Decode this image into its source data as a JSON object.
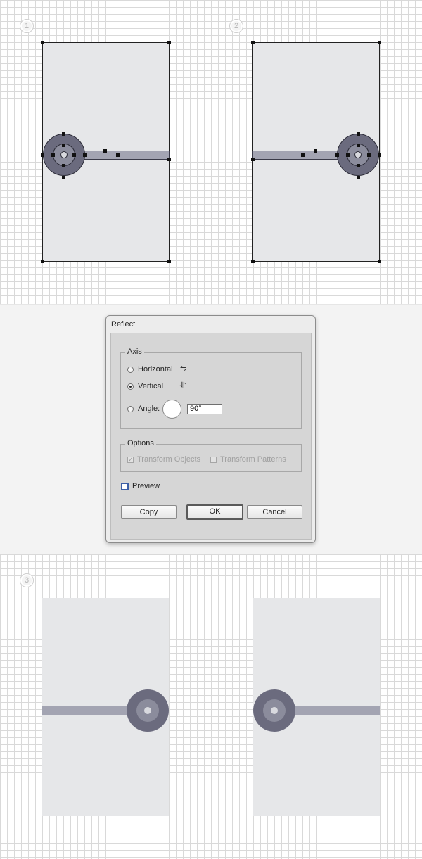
{
  "steps": {
    "s1": "1",
    "s2": "2",
    "s3": "3"
  },
  "colors": {
    "card": "#e6e7e9",
    "bar": "#a3a4b2",
    "ring_outer": "#6b6b7e",
    "ring_mid": "#8b8c9c",
    "ring_dot": "#d8d9de",
    "preview_checkbox": "#3b5ea6"
  },
  "dialog": {
    "title": "Reflect",
    "axis_legend": "Axis",
    "horizontal_label": "Horizontal",
    "vertical_label": "Vertical",
    "angle_label": "Angle:",
    "angle_value": "90°",
    "selected_axis": "Vertical",
    "horizontal_icon": "⇋",
    "vertical_icon": "⥯",
    "options_legend": "Options",
    "transform_objects_label": "Transform Objects",
    "transform_patterns_label": "Transform Patterns",
    "transform_objects_checked": true,
    "transform_patterns_checked": false,
    "preview_label": "Preview",
    "preview_checked": false,
    "copy_button": "Copy",
    "ok_button": "OK",
    "cancel_button": "Cancel"
  }
}
